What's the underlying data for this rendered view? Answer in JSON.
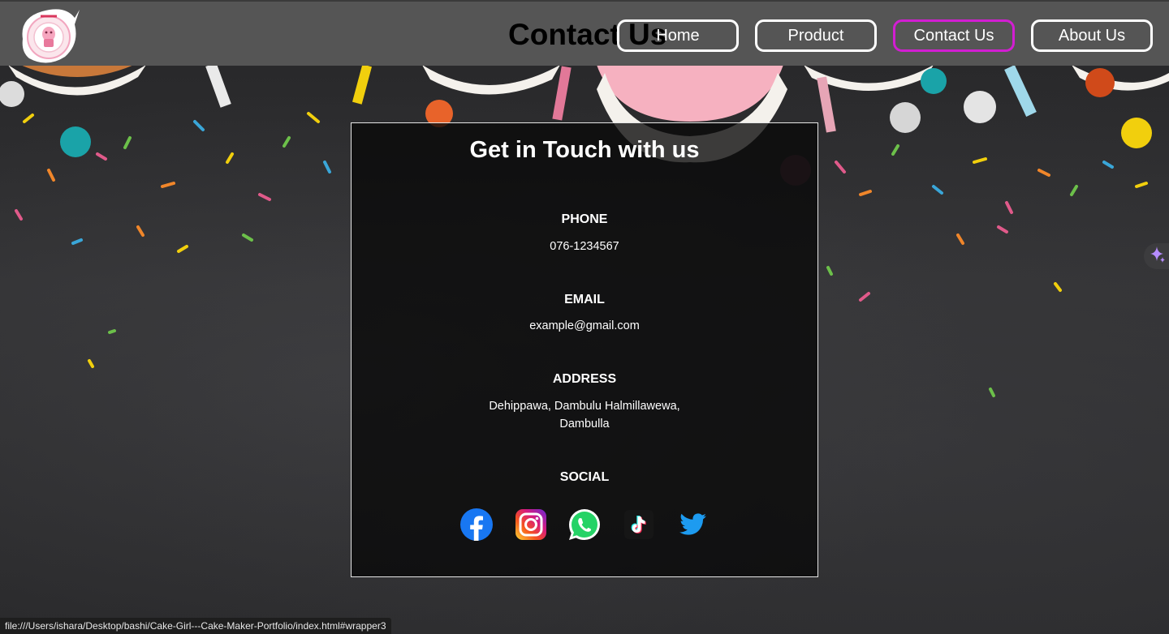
{
  "header": {
    "logo_icon": "cake-girl-logo-icon",
    "page_heading": "Contact Us",
    "nav": [
      {
        "label": "Home",
        "active": false
      },
      {
        "label": "Product",
        "active": false
      },
      {
        "label": "Contact Us",
        "active": true
      },
      {
        "label": "About Us",
        "active": false
      }
    ],
    "active_color": "#d21ed2"
  },
  "contact": {
    "title": "Get in Touch with us",
    "phone_label": "PHONE",
    "phone_value": "076-1234567",
    "email_label": "EMAIL",
    "email_value": "example@gmail.com",
    "address_label": "ADDRESS",
    "address_line1": "Dehippawa, Dambulu Halmillawewa,",
    "address_line2": "Dambulla",
    "social_label": "SOCIAL",
    "social": [
      {
        "icon": "facebook-icon",
        "color": "#1877f2"
      },
      {
        "icon": "instagram-icon",
        "color": "#e1306c"
      },
      {
        "icon": "whatsapp-icon",
        "color": "#25d366"
      },
      {
        "icon": "tiktok-icon",
        "color": "#111111"
      },
      {
        "icon": "twitter-icon",
        "color": "#1d9bf0"
      }
    ]
  },
  "status_bar": {
    "url": "file:///Users/ishara/Desktop/bashi/Cake-Girl---Cake-Maker-Portfolio/index.html#wrapper3"
  }
}
